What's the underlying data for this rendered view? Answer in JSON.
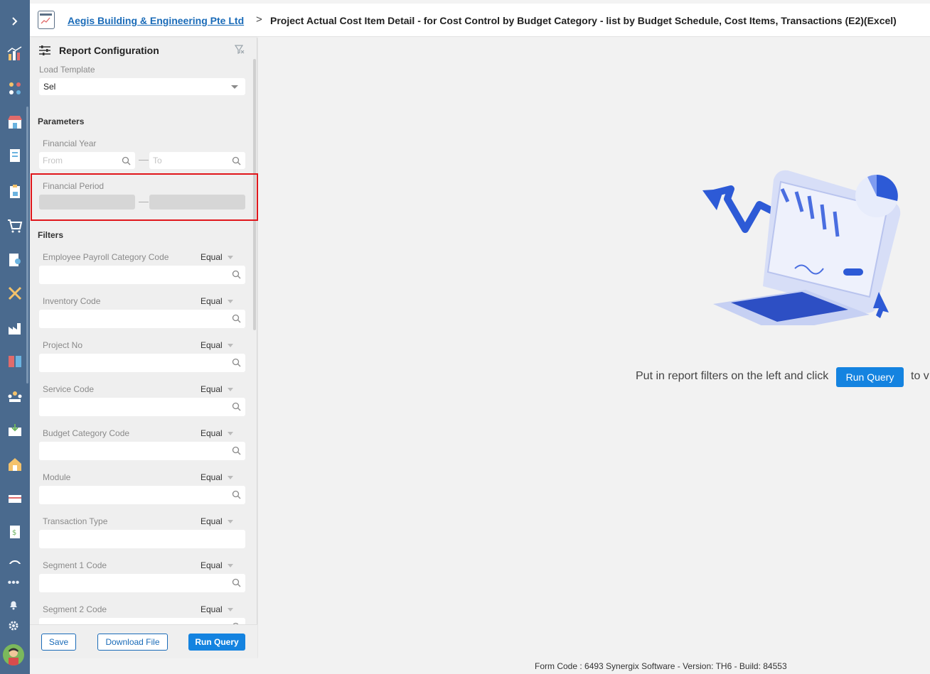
{
  "header": {
    "company": "Aegis Building & Engineering Pte Ltd",
    "separator": ">",
    "title": "Project Actual Cost Item Detail - for Cost Control by Budget Category - list by Budget Schedule, Cost Items, Transactions (E2)(Excel)"
  },
  "panel": {
    "title": "Report Configuration",
    "load_template_label": "Load Template",
    "load_template_value": "Sel",
    "parameters_label": "Parameters",
    "financial_year_label": "Financial Year",
    "from_placeholder": "From",
    "to_placeholder": "To",
    "financial_period_label": "Financial Period",
    "filters_label": "Filters",
    "filters": [
      {
        "label": "Employee Payroll Category Code",
        "op": "Equal"
      },
      {
        "label": "Inventory Code",
        "op": "Equal"
      },
      {
        "label": "Project No",
        "op": "Equal"
      },
      {
        "label": "Service Code",
        "op": "Equal"
      },
      {
        "label": "Budget Category Code",
        "op": "Equal"
      },
      {
        "label": "Module",
        "op": "Equal"
      },
      {
        "label": "Transaction Type",
        "op": "Equal"
      },
      {
        "label": "Segment 1 Code",
        "op": "Equal"
      },
      {
        "label": "Segment 2 Code",
        "op": "Equal"
      }
    ],
    "save_label": "Save",
    "download_label": "Download File",
    "run_label": "Run Query"
  },
  "main": {
    "cta_text": "Put in report filters on the left and click",
    "cta_button": "Run Query",
    "cta_tail": "to v"
  },
  "footer": {
    "text": "Form Code : 6493    Synergix Software - Version: TH6 - Build: 84553"
  },
  "colors": {
    "rail": "#4a6a8e",
    "accent": "#1483e0",
    "highlight": "#e0161b"
  }
}
